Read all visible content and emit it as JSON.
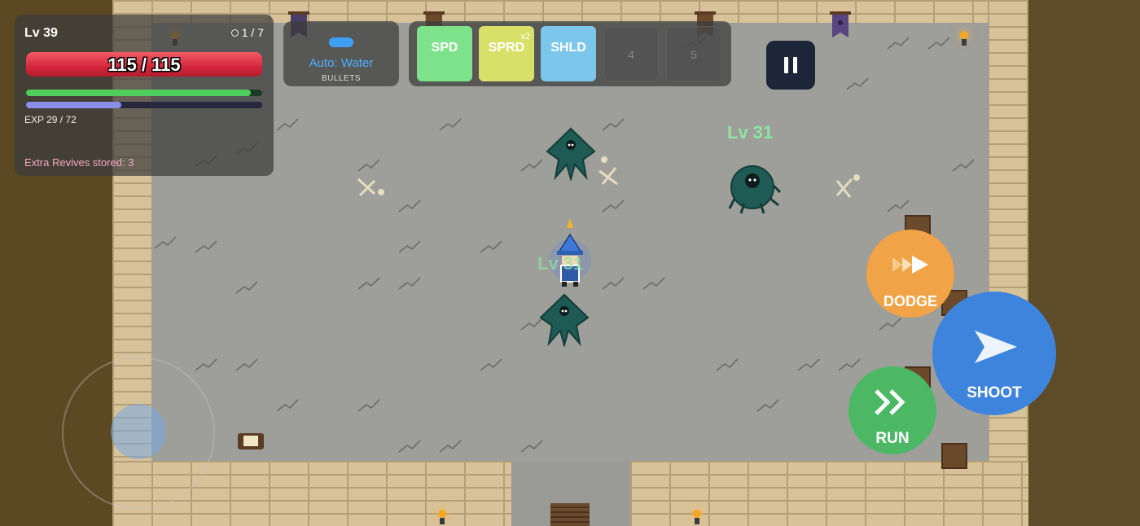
{
  "player": {
    "level_label": "Lv 39",
    "hp_text": "115 / 115",
    "hp_fraction": 1.0,
    "stamina_fraction": 0.95,
    "exp_text": "EXP 29 / 72",
    "exp_fraction": 0.4028,
    "revives_text": "Extra Revives stored: 3",
    "label": "Lv 31"
  },
  "wave": {
    "text": "1 / 7"
  },
  "weapon": {
    "name": "Auto: Water",
    "type": "BULLETS"
  },
  "skills": [
    {
      "label": "SPD",
      "color": "#7de28a",
      "multiplier": ""
    },
    {
      "label": "SPRD",
      "color": "#d9e06a",
      "multiplier": "x2"
    },
    {
      "label": "SHLD",
      "color": "#7cc6ec",
      "multiplier": ""
    },
    {
      "label": "4",
      "color": "",
      "multiplier": ""
    },
    {
      "label": "5",
      "color": "",
      "multiplier": ""
    }
  ],
  "enemies": [
    {
      "label": "Lv 31"
    }
  ],
  "controls": {
    "dodge_label": "DODGE",
    "shoot_label": "SHOOT",
    "run_label": "RUN",
    "dodge_color": "#f0a347",
    "shoot_color": "#3f84dc",
    "run_color": "#4cb865"
  },
  "icons": {
    "pause": "pause-icon",
    "dodge": "double-arrow-icon",
    "shoot": "paper-plane-icon",
    "run": "chevrons-right-icon"
  }
}
